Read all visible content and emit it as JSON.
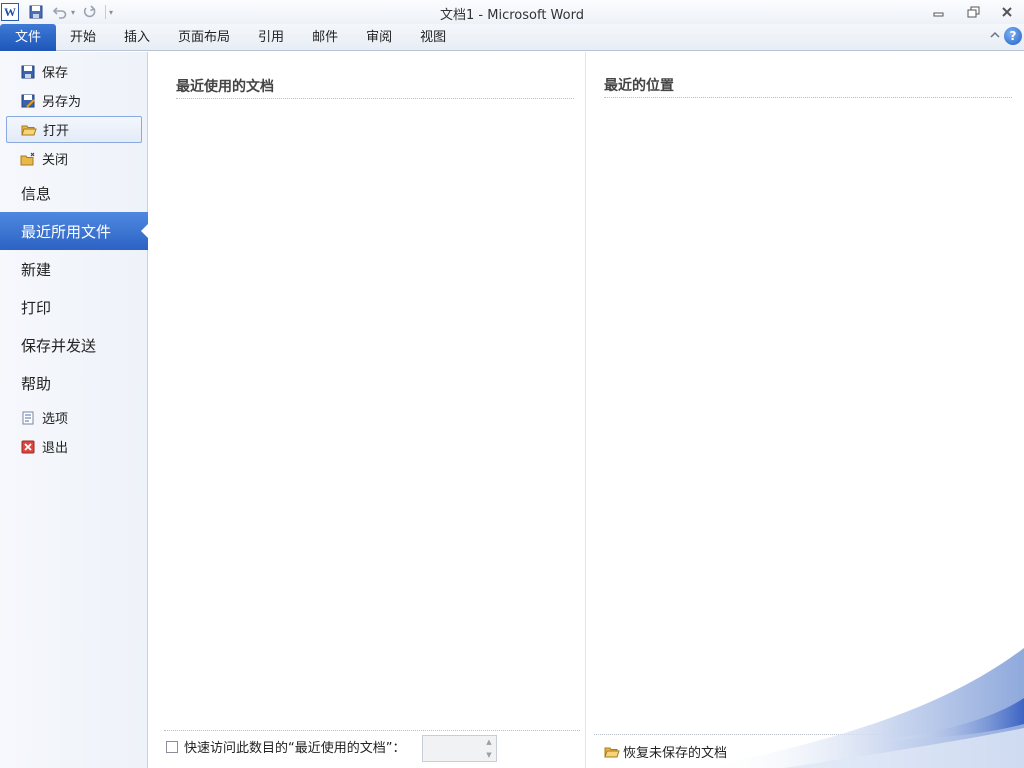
{
  "window": {
    "title": "文档1  -  Microsoft Word",
    "logo_letter": "W"
  },
  "ribbon": {
    "file_tab": "文件",
    "tabs": [
      "开始",
      "插入",
      "页面布局",
      "引用",
      "邮件",
      "审阅",
      "视图"
    ],
    "help_label": "?"
  },
  "backstage_nav": {
    "commands_top": [
      {
        "label": "保存",
        "icon": "save-icon"
      },
      {
        "label": "另存为",
        "icon": "save-as-icon"
      },
      {
        "label": "打开",
        "icon": "open-folder-icon",
        "selected": true
      },
      {
        "label": "关闭",
        "icon": "close-folder-icon"
      }
    ],
    "tabs": [
      {
        "label": "信息"
      },
      {
        "label": "最近所用文件",
        "active": true
      },
      {
        "label": "新建"
      },
      {
        "label": "打印"
      },
      {
        "label": "保存并发送"
      },
      {
        "label": "帮助"
      }
    ],
    "commands_bottom": [
      {
        "label": "选项",
        "icon": "options-icon"
      },
      {
        "label": "退出",
        "icon": "exit-icon"
      }
    ]
  },
  "recent": {
    "documents_title": "最近使用的文档",
    "places_title": "最近的位置",
    "quick_access_label": "快速访问此数目的“最近使用的文档”：",
    "quick_access_checked": false,
    "quick_access_value": "",
    "recover_label": "恢复未保存的文档"
  },
  "colors": {
    "accent": "#2c63c4",
    "file_tab": "#1d56b8"
  }
}
